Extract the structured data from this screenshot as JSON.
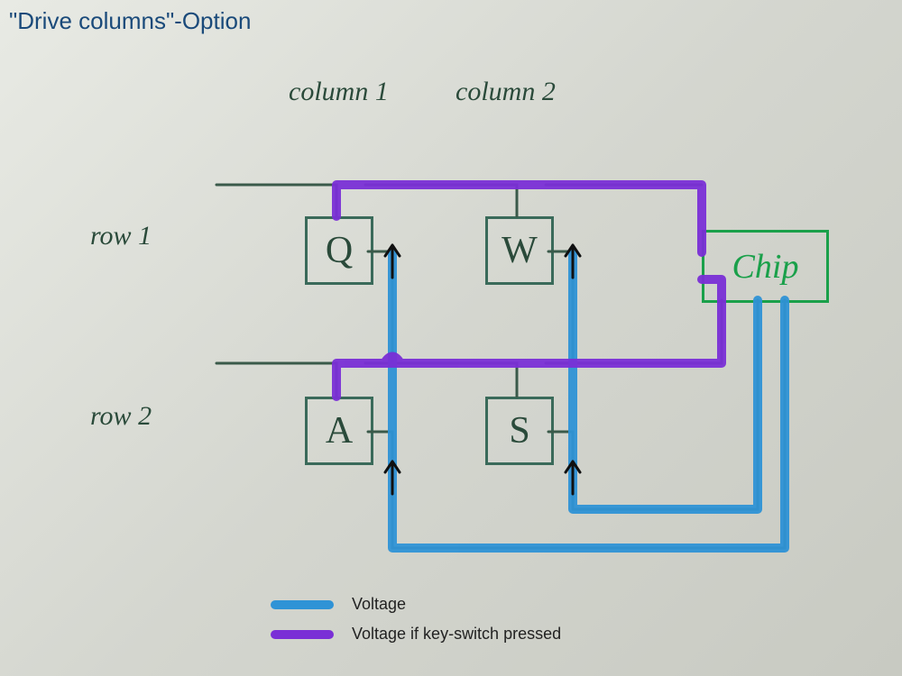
{
  "title": "\"Drive columns\"-Option",
  "labels": {
    "column1": "column 1",
    "column2": "column 2",
    "row1": "row 1",
    "row2": "row 2",
    "chip": "Chip"
  },
  "keys": {
    "q": "Q",
    "w": "W",
    "a": "A",
    "s": "S"
  },
  "legend": {
    "voltage": "Voltage",
    "voltage_pressed": "Voltage if key-switch pressed"
  },
  "colors": {
    "voltage": "#2f93d6",
    "voltage_pressed": "#7a2fd6",
    "pen_wire": "#3a5a4a",
    "pen_box": "#3a6a5a",
    "chip_green": "#1aa04a",
    "title": "#1a4a7a"
  },
  "diagram": {
    "grid": {
      "columns": [
        "column 1",
        "column 2"
      ],
      "rows": [
        "row 1",
        "row 2"
      ],
      "switches": [
        {
          "row": 1,
          "col": 1,
          "key": "Q"
        },
        {
          "row": 1,
          "col": 2,
          "key": "W"
        },
        {
          "row": 2,
          "col": 1,
          "key": "A"
        },
        {
          "row": 2,
          "col": 2,
          "key": "S"
        }
      ],
      "diodes_each_switch": true,
      "diode_direction": "column-to-row"
    },
    "drive": "columns",
    "read": "rows",
    "voltage_path_blue": {
      "from": "Chip / column driver",
      "through": [
        "column 1",
        "column 2"
      ],
      "note": "columns energized from chip along bottom bus"
    },
    "voltage_path_purple": {
      "condition": "key-switch pressed",
      "through": [
        "row 1",
        "row 2"
      ],
      "back_to": "Chip / row sense",
      "note": "rows carry voltage back to chip when a switch closes"
    }
  }
}
